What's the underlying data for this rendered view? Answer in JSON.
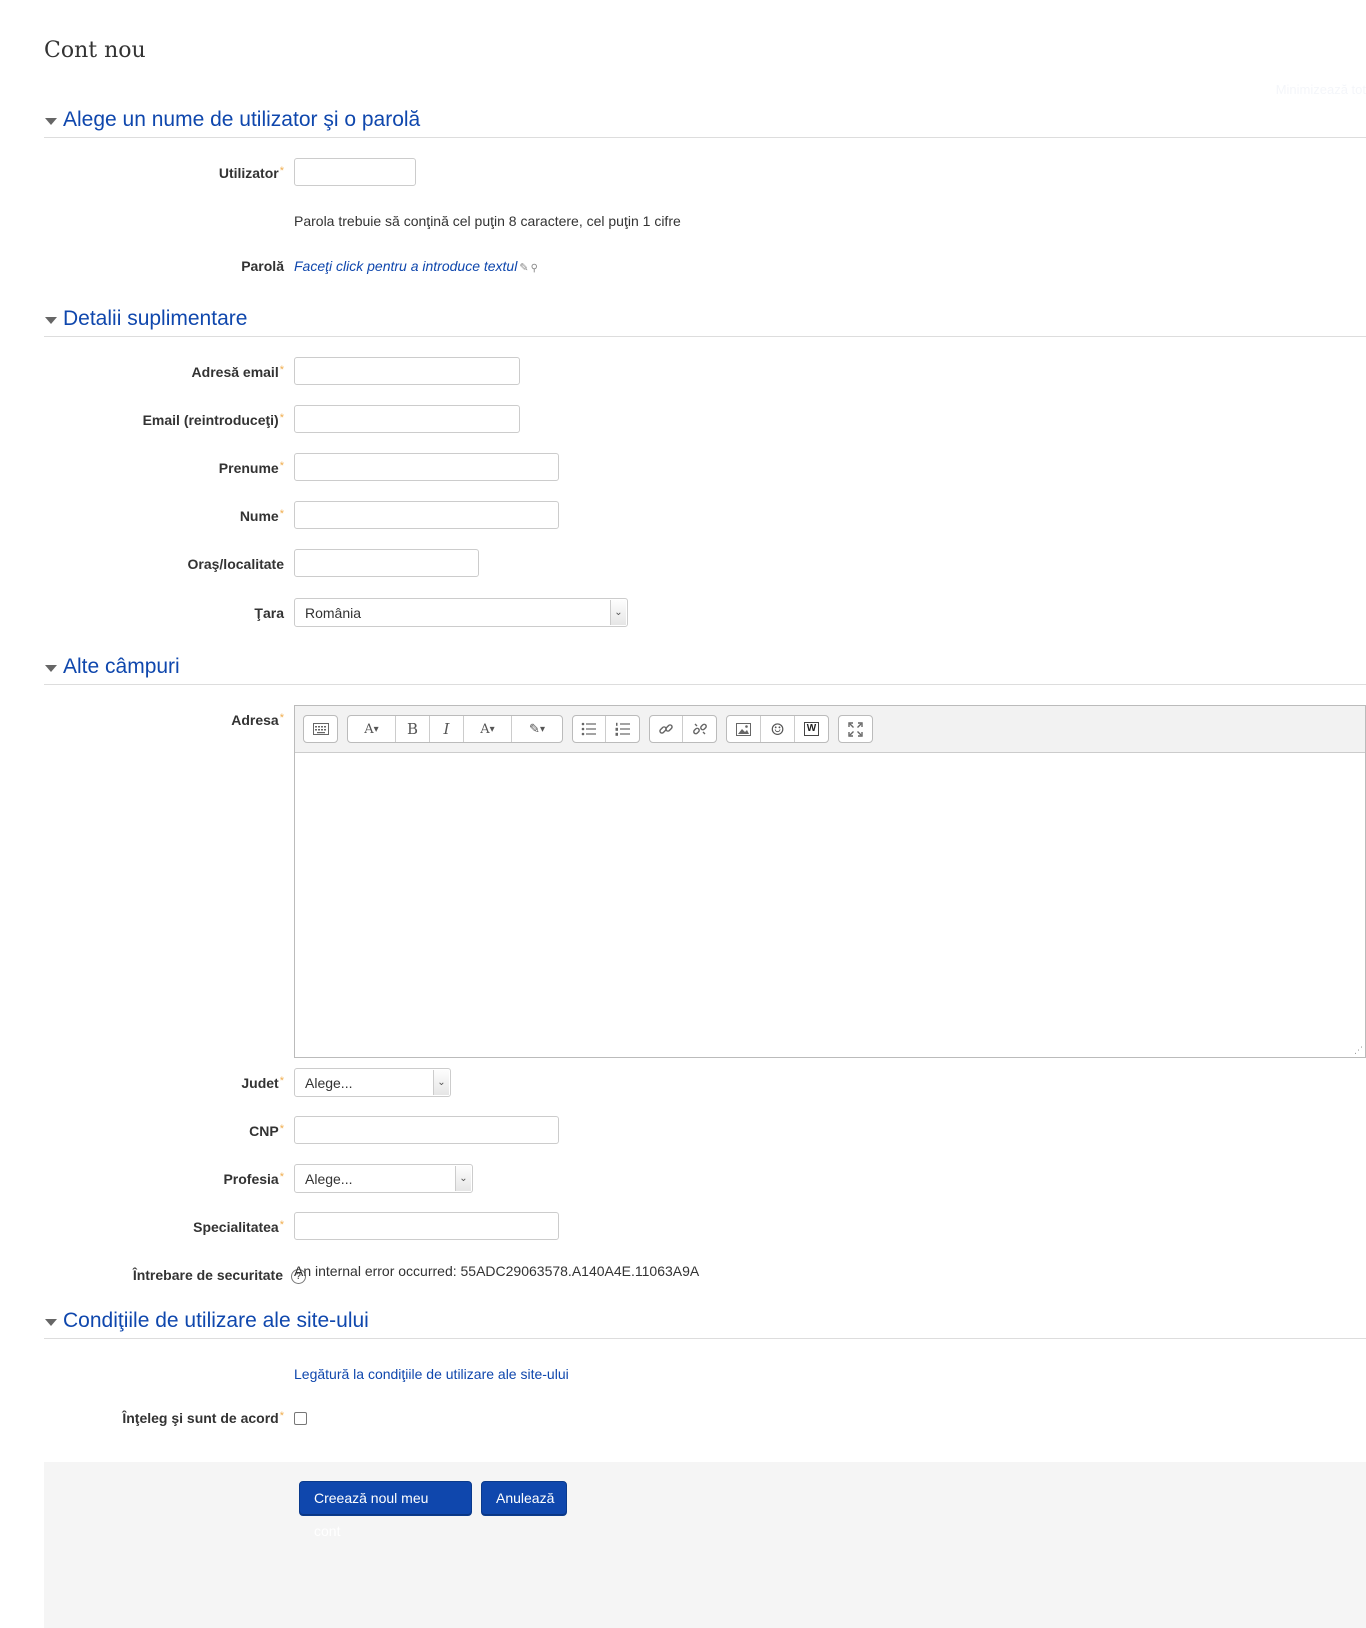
{
  "page": {
    "title": "Cont nou",
    "collapse_all": "Minimizează tot"
  },
  "sections": {
    "account": {
      "title": "Alege un nume de utilizator şi o parolă"
    },
    "details": {
      "title": "Detalii suplimentare"
    },
    "other": {
      "title": "Alte câmpuri"
    },
    "policy": {
      "title": "Condiţiile de utilizare ale site-ului"
    }
  },
  "fields": {
    "username": {
      "label": "Utilizator",
      "required_mark": "*",
      "value": ""
    },
    "password_rules": "Parola trebuie să conţină cel puţin 8 caractere, cel puţin 1 cifre",
    "password": {
      "label": "Parolă",
      "placeholder_link": "Faceţi click pentru a introduce textul"
    },
    "email": {
      "label": "Adresă email",
      "required_mark": "*",
      "value": ""
    },
    "email2": {
      "label": "Email (reintroduceţi)",
      "required_mark": "*",
      "value": ""
    },
    "firstname": {
      "label": "Prenume",
      "required_mark": "*",
      "value": ""
    },
    "lastname": {
      "label": "Nume",
      "required_mark": "*",
      "value": ""
    },
    "city": {
      "label": "Oraş/localitate",
      "value": ""
    },
    "country": {
      "label": "Ţara",
      "selected": "România"
    },
    "address": {
      "label": "Adresa",
      "required_mark": "*"
    },
    "county": {
      "label": "Judet",
      "required_mark": "*",
      "selected": "Alege..."
    },
    "cnp": {
      "label": "CNP",
      "required_mark": "*",
      "value": ""
    },
    "profession": {
      "label": "Profesia",
      "required_mark": "*",
      "selected": "Alege..."
    },
    "specialty": {
      "label": "Specialitatea",
      "required_mark": "*",
      "value": ""
    },
    "security": {
      "label": "Întrebare de securitate",
      "error": "An internal error occurred: 55ADC29063578.A140A4E.11063A9A"
    },
    "policy_link": "Legătură la condiţiile de utilizare ale site-ului",
    "agree": {
      "label": "Înţeleg şi sunt de acord",
      "required_mark": "*"
    }
  },
  "editor_toolbar": {
    "bold": "B",
    "italic": "I",
    "font": "A",
    "color": "A",
    "word": "W"
  },
  "buttons": {
    "submit": "Creează noul meu cont",
    "cancel": "Anulează"
  },
  "colors": {
    "accent": "#0f47ad",
    "required": "#f0ad4e"
  }
}
